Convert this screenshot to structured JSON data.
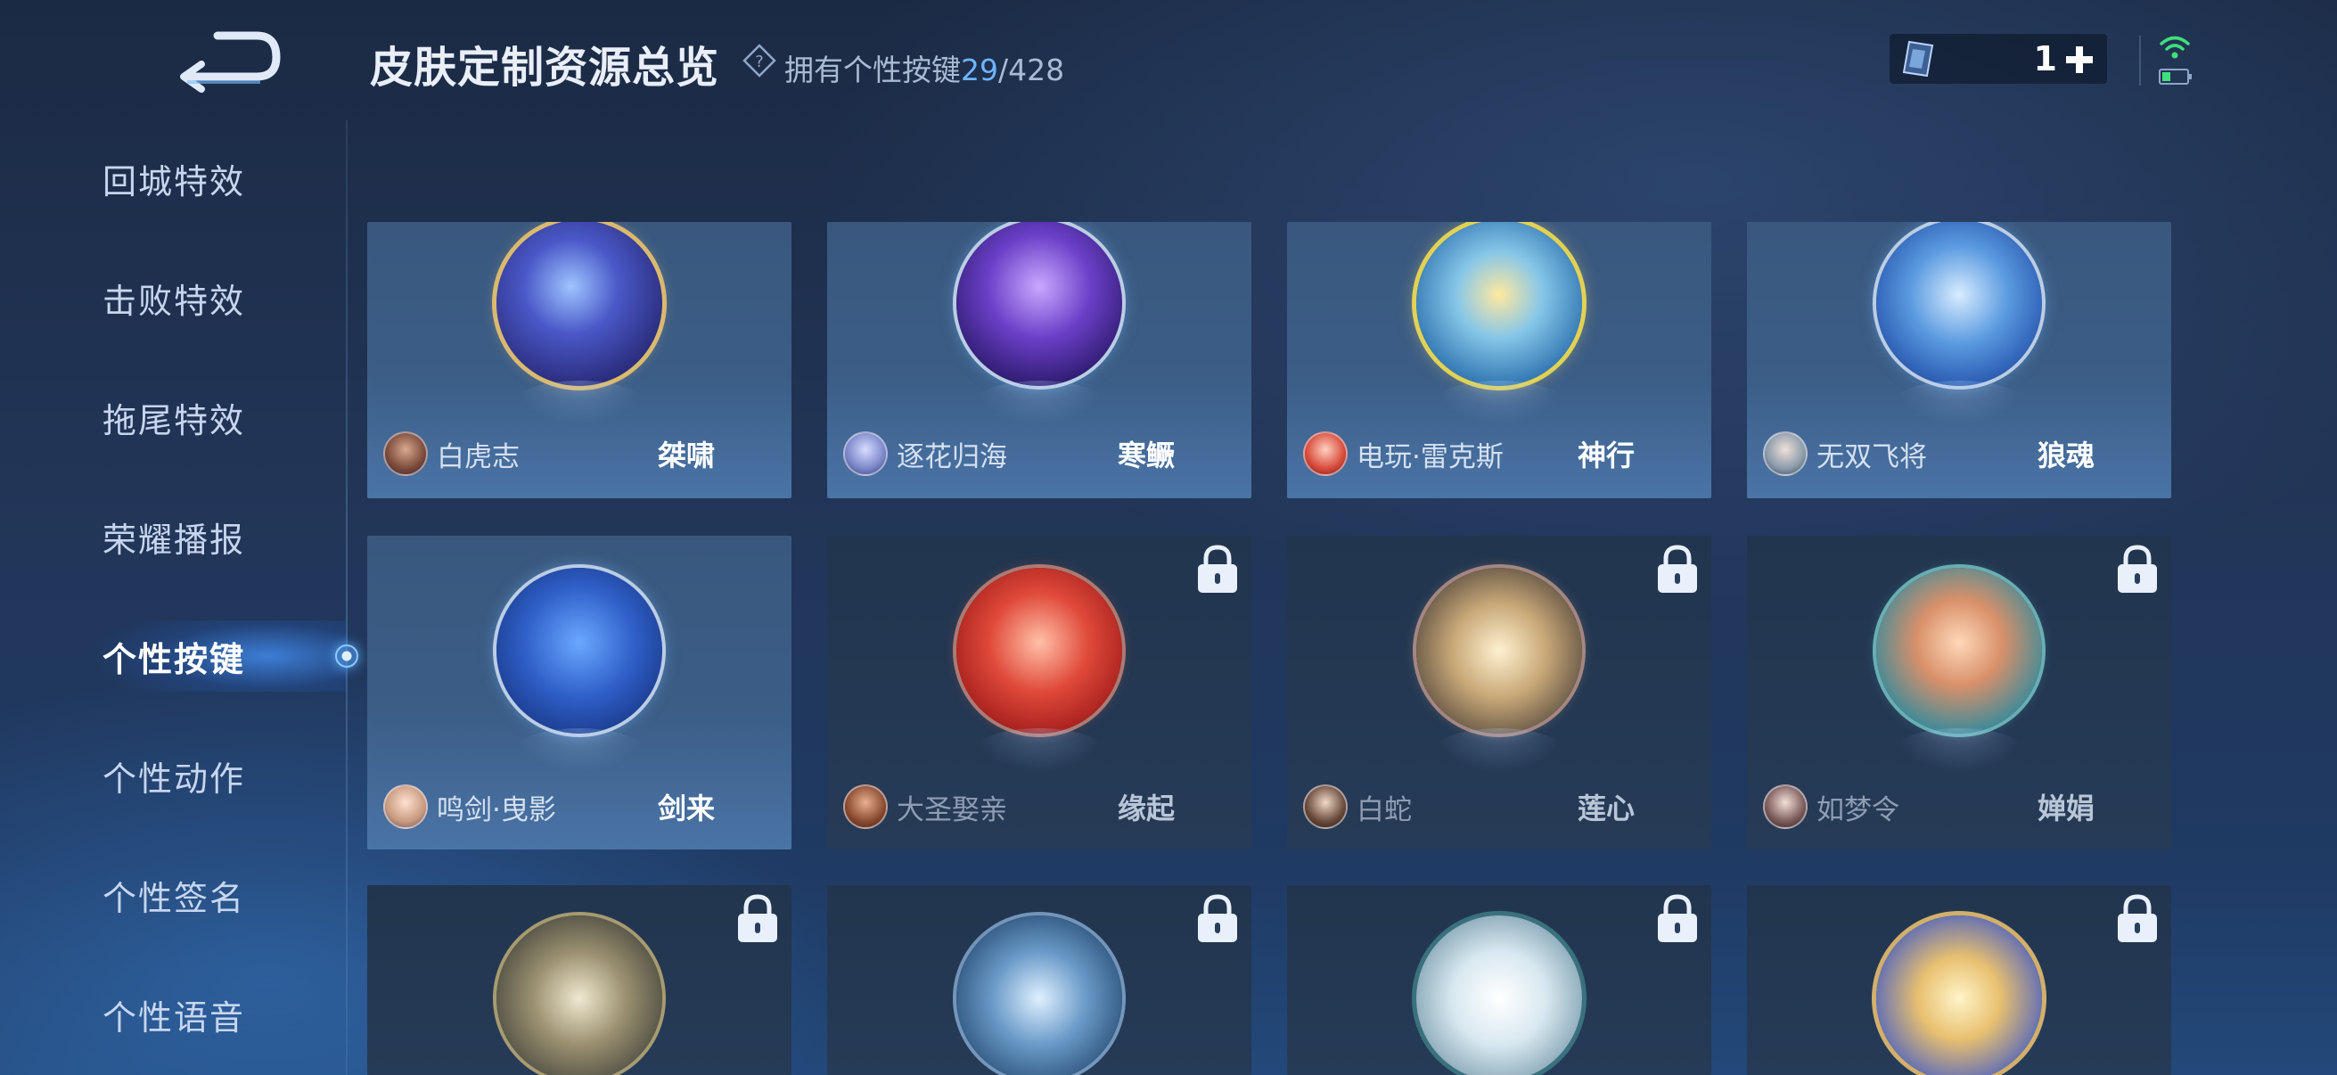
{
  "header": {
    "title": "皮肤定制资源总览",
    "owned_label": "拥有个性按键",
    "owned_count": "29",
    "owned_total": "/428",
    "currency_value": "1"
  },
  "icons": {
    "back": "back-arrow-icon",
    "help": "question-diamond-icon",
    "currency": "crystal-card-icon",
    "add": "plus-icon",
    "wifi": "wifi-icon",
    "battery": "battery-icon",
    "lock": "lock-icon"
  },
  "colors": {
    "accent": "#6fb4ff",
    "active_tab_glow": "#3f8cff",
    "wifi": "#3fe07a"
  },
  "sidebar": {
    "active_index": 4,
    "items": [
      {
        "label": "回城特效"
      },
      {
        "label": "击败特效"
      },
      {
        "label": "拖尾特效"
      },
      {
        "label": "荣耀播报"
      },
      {
        "label": "个性按键"
      },
      {
        "label": "个性动作"
      },
      {
        "label": "个性签名"
      },
      {
        "label": "个性语音"
      }
    ]
  },
  "cards": [
    {
      "hero": "白虎志",
      "skin": "桀啸",
      "locked": false
    },
    {
      "hero": "逐花归海",
      "skin": "寒鳜",
      "locked": false
    },
    {
      "hero": "电玩·雷克斯",
      "skin": "神行",
      "locked": false
    },
    {
      "hero": "无双飞将",
      "skin": "狼魂",
      "locked": false
    },
    {
      "hero": "鸣剑·曳影",
      "skin": "剑来",
      "locked": false
    },
    {
      "hero": "大圣娶亲",
      "skin": "缘起",
      "locked": true
    },
    {
      "hero": "白蛇",
      "skin": "莲心",
      "locked": true
    },
    {
      "hero": "如梦令",
      "skin": "婵娟",
      "locked": true
    },
    {
      "hero": "",
      "skin": "",
      "locked": true
    },
    {
      "hero": "",
      "skin": "",
      "locked": true
    },
    {
      "hero": "",
      "skin": "",
      "locked": true
    },
    {
      "hero": "",
      "skin": "",
      "locked": true
    }
  ]
}
